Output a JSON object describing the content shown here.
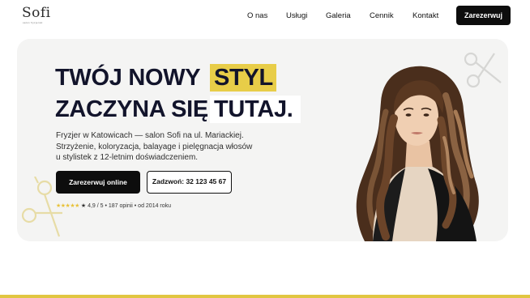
{
  "brand": {
    "name": "Sofi",
    "tagline": "salon fryzjerski"
  },
  "nav": {
    "links": [
      "O nas",
      "Usługi",
      "Galeria",
      "Cennik",
      "Kontakt"
    ],
    "cta": "Zarezerwuj"
  },
  "hero": {
    "headline_line1_part1": "TWÓJ NOWY",
    "headline_line1_highlight": "STYL",
    "headline_line2_part1": "ZACZYNA SIĘ",
    "headline_line2_highlight": "TUTAJ.",
    "lead_lines": [
      "Fryzjer w Katowicach — salon Sofi na ul. Mariackiej.",
      "Strzyżenie, koloryzacja, balayage i pielęgnacja włosów",
      "u stylistek z 12-letnim doświadczeniem."
    ],
    "primary_button": "Zarezerwuj online",
    "secondary_button": "Zadzwoń: 32 123 45 67",
    "rating": {
      "stars": "★★★★★",
      "text": "★ 4,9 / 5 • 187 opinii • od 2014 roku"
    }
  },
  "colors": {
    "accent_yellow": "#e8cd48",
    "dark": "#0d0d0d",
    "hero_bg": "#f4f4f3",
    "headline": "#12142b"
  },
  "icons": [
    "scissors-icon",
    "star-icon"
  ]
}
